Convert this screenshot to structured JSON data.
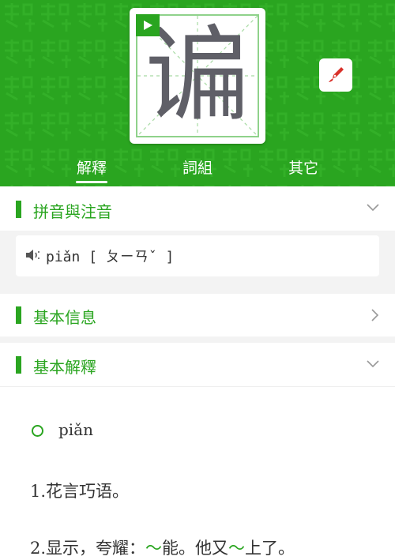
{
  "character": "谝",
  "tabs": [
    {
      "label": "解釋",
      "active": true
    },
    {
      "label": "詞組",
      "active": false
    },
    {
      "label": "其它",
      "active": false
    }
  ],
  "sections": {
    "pinyin": {
      "title": "拼音與注音",
      "chevron": "down"
    },
    "basic_info": {
      "title": "基本信息",
      "chevron": "right"
    },
    "basic_explain": {
      "title": "基本解釋",
      "chevron": "down"
    }
  },
  "pronunciation": {
    "pinyin": "piǎn",
    "zhuyin": "[ ㄆㄧㄢˇ ]"
  },
  "explanation": {
    "reading": "piǎn",
    "definitions": [
      {
        "num": "1.",
        "parts": [
          "花言巧语。"
        ]
      },
      {
        "num": "2.",
        "parts": [
          "显示，夸耀：",
          "～",
          "能。他又",
          "～",
          "上了。"
        ]
      }
    ]
  },
  "colors": {
    "accent": "#2aa520",
    "glyph": "#5f5f67"
  },
  "icons": [
    "play-icon",
    "brush-icon",
    "speaker-icon",
    "chevron-down-icon",
    "chevron-right-icon",
    "circle-icon"
  ]
}
